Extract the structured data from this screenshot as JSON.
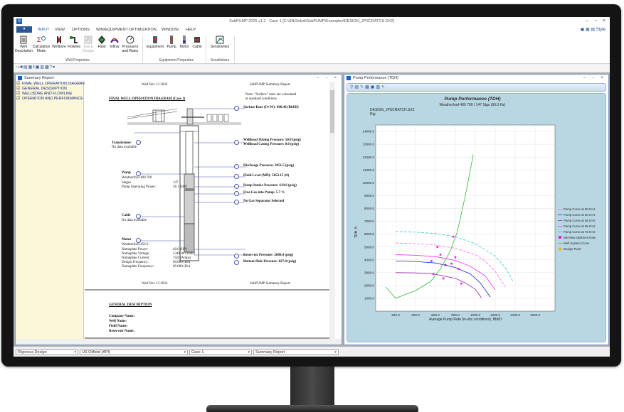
{
  "app": {
    "title": "SubPUMP 2025 v1.2 - Case 1 [C:\\SNGlobal\\SubPUMP\\Examples\\DESIGN_JPSCRATCH.SX2]",
    "file_button": "▾",
    "menu_tabs": [
      "INPUT",
      "VIEW",
      "OPTIONS",
      "WIN/EQUIPMENT",
      "OPTIMIZATION",
      "WINDOW",
      "HELP"
    ],
    "style_label": "Style"
  },
  "ribbon": {
    "well_properties": {
      "buttons": [
        "Well Description",
        "Calculation Mode",
        "Wellbore",
        "Flowline",
        "Quick Design",
        "Fluid",
        "Inflow",
        "Pressures and Rates"
      ],
      "label": "Well Properties"
    },
    "equipment_properties": {
      "buttons": [
        "Equipment",
        "Pump",
        "Motor",
        "Cable"
      ],
      "label": "Equipment Properties"
    },
    "sensitivities": {
      "buttons": [
        "Sensitivities"
      ],
      "label": "Sensitivities"
    }
  },
  "summary_window": {
    "title": "Summary Report",
    "tree": [
      "FINAL WELL OPERATION DIAGRAM",
      "GENERAL DESCRIPTION",
      "WELLBORE AND FLOWLINE",
      "OPERATION AND PERFORMANCE"
    ],
    "page_date": "Wed Nov 13 2024",
    "page_header_right": "SubPUMP Summary Report",
    "diagram_title": "FINAL WELL OPERATION DIAGRAM (Case 1)",
    "note": [
      "Note: \"Surface\" rates are calculated",
      "at standard conditions"
    ],
    "surface_rate": "Surface Rate (O+W): 600.46 (Bbl/D)",
    "wellhead_tubing": "Wellhead Tubing Pressure: 50.0 (psig)",
    "wellhead_casing": "Wellhead Casing Pressure: 0.0 (psig)",
    "transformer_label": "Transformer",
    "transformer_value": "No data available",
    "discharge_pressure": "Discharge Pressure: 2051.5 (psig)",
    "fluid_level": "Fluid Level (MD): 5052.15 (ft)",
    "pump_intake": "Pump Intake Pressure: 619.6 (psig)",
    "free_gas": "Free Gas into Pump: 5.7 %",
    "gas_separator": "No Gas Separator Selected",
    "pump_label": "Pump",
    "pump_model": "Weatherford 400 700",
    "pump_stages_label": "Stages",
    "pump_stages": "147",
    "pump_power_label": "Pump Operating Power:",
    "pump_power": "28.1 (HP)",
    "cable_label": "Cable",
    "cable_value": "No data available",
    "motor_label": "Motor",
    "motor_model": "Weatherford 456 S",
    "motor_rows": [
      {
        "k": "Nameplate Power:",
        "v": "40.0 (HP)"
      },
      {
        "k": "Nameplate Voltage:",
        "v": "1340.00 (Volts)"
      },
      {
        "k": "Nameplate Current:",
        "v": "19.0 (Amps)"
      },
      {
        "k": "Design Frequency:",
        "v": "60.000 (Hz)"
      },
      {
        "k": "Nameplate Frequency:",
        "v": "60.000 (Hz)"
      }
    ],
    "reservoir_pressure": "Reservoir Pressure: 2000.0 (psig)",
    "bottom_hole": "Bottom Hole Pressure: 827.0 (psig)",
    "general_title": "GENERAL DESCRIPTION",
    "general_fields": [
      "Company Name:",
      "Well Name:",
      "Field Name:",
      "Reservoir Name:"
    ]
  },
  "chart_window": {
    "title": "Pump Performance (TDH)",
    "legend": [
      "Pump Curve at 80.0 Hz",
      "Pump Curve at 60.0 Hz",
      "Pump Curve at 55.0 Hz",
      "Pump Curve at 65.0 Hz",
      "Pump Curve at 70.0 Hz",
      "Min-Max Optimum Rate",
      "Well System Curve",
      "Design Point"
    ]
  },
  "status_bar": {
    "design_mode": "Rigorous Design",
    "units": "US Oilfield (API)",
    "case": "Case 1",
    "report": "Summary Report"
  },
  "colors": {
    "accent": "#1e5fb8",
    "tree_bg": "#fbf7d8",
    "chart_bg": "#b9d7e3",
    "plot_bg": "#ffffff",
    "well_system": "#33bb33",
    "optimum_points": "#dd22dd"
  },
  "chart_data": {
    "type": "line",
    "title": "Pump Performance (TDH)",
    "subtitle": "Weatherford 400 700 / 147 Stgs (60.0 Hz)",
    "case_label": "DESIGN_JPSCRATCH.SX2",
    "case_label2": "Rig",
    "xlabel": "Average Pump Rate (in-situ conditions), Bbl/D",
    "ylabel": "TDH, ft",
    "xlim": [
      0,
      1800
    ],
    "ylim": [
      0,
      14500
    ],
    "xticks": [
      200,
      400,
      600,
      800,
      1000,
      1200,
      1400,
      1600
    ],
    "yticks": [
      1000,
      2000,
      3000,
      4000,
      5000,
      6000,
      7000,
      8000,
      9000,
      10000,
      11000,
      12000,
      13000,
      14000
    ],
    "xtick_labels": [
      "200.0",
      "400.0",
      "600.0",
      "800.0",
      "1000.0",
      "1200.0",
      "1400.0",
      "1600.0"
    ],
    "ytick_labels": [
      "1000.0",
      "2000.0",
      "3000.0",
      "4000.0",
      "5000.0",
      "6000.0",
      "7000.0",
      "8000.0",
      "9000.0",
      "10000.0",
      "11000.0",
      "12000.0",
      "13000.0",
      "14000.0"
    ],
    "series": [
      {
        "color": "#ff66ff",
        "dash": "4,2",
        "x": [
          200,
          400,
          600,
          800,
          1000,
          1100,
          1200,
          1300
        ],
        "y": [
          5300,
          5250,
          5150,
          4900,
          4400,
          3900,
          3100,
          1900
        ]
      },
      {
        "color": "#2222dd",
        "dash": "",
        "x": [
          200,
          400,
          600,
          800,
          950,
          1050,
          1150
        ],
        "y": [
          3900,
          3870,
          3750,
          3400,
          2900,
          2200,
          1100
        ]
      },
      {
        "color": "#9922aa",
        "dash": "",
        "x": [
          200,
          400,
          600,
          800,
          900,
          1000,
          1060
        ],
        "y": [
          3000,
          2980,
          2870,
          2550,
          2200,
          1700,
          1050
        ]
      },
      {
        "color": "#ff22ff",
        "dash": "",
        "x": [
          200,
          400,
          600,
          800,
          950,
          1100,
          1200
        ],
        "y": [
          4400,
          4350,
          4250,
          3950,
          3500,
          2750,
          1650
        ]
      },
      {
        "color": "#33cccc",
        "dash": "4,2",
        "x": [
          200,
          400,
          600,
          800,
          1000,
          1200,
          1300,
          1380
        ],
        "y": [
          6200,
          6150,
          6050,
          5800,
          5250,
          4300,
          3400,
          2300
        ]
      },
      {
        "color": "#33bb33",
        "dash": "",
        "x": [
          100,
          200,
          400,
          550,
          650,
          750,
          820,
          900,
          980
        ],
        "y": [
          1900,
          1000,
          1600,
          2300,
          3300,
          4700,
          6200,
          9000,
          12200
        ]
      }
    ],
    "optimum_points": [
      [
        620,
        5000
      ],
      [
        560,
        3900
      ],
      [
        580,
        2900
      ],
      [
        650,
        4400
      ],
      [
        780,
        5800
      ],
      [
        760,
        3700
      ],
      [
        680,
        2550
      ],
      [
        830,
        3300
      ],
      [
        860,
        2150
      ],
      [
        800,
        4200
      ]
    ],
    "well_system_marker": [
      [
        700,
        3600
      ]
    ]
  }
}
